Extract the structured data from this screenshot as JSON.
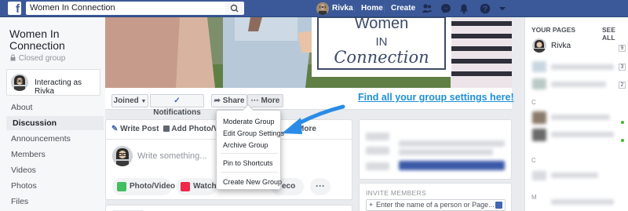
{
  "topbar": {
    "logo_letter": "f",
    "search_value": "Women In Connection",
    "user_name": "Rivka",
    "home_label": "Home",
    "create_label": "Create",
    "help_glyph": "?"
  },
  "group": {
    "title": "Women In Connection",
    "privacy": "Closed group",
    "interacting_as": "Interacting as Rivka"
  },
  "nav": {
    "items": [
      {
        "label": "About",
        "active": false
      },
      {
        "label": "Discussion",
        "active": true
      },
      {
        "label": "Announcements",
        "active": false
      },
      {
        "label": "Members",
        "active": false
      },
      {
        "label": "Videos",
        "active": false
      },
      {
        "label": "Photos",
        "active": false
      },
      {
        "label": "Files",
        "active": false
      }
    ]
  },
  "cover": {
    "sign_line1": "Women",
    "sign_line2": "IN",
    "sign_line3": "Connection"
  },
  "actions": {
    "joined": "Joined",
    "notifications": "Notifications",
    "share": "Share",
    "more": "More",
    "more_dots": "···"
  },
  "callout": "Find all your group settings here!",
  "composer": {
    "write_post": "Write Post",
    "add_photo": "Add Photo/Vid",
    "more_tab": "More",
    "placeholder": "Write something...",
    "chip_photo": "Photo/Video",
    "chip_watch": "Watch P",
    "chip_third": "eco",
    "more_chip": "···"
  },
  "menu": {
    "items": [
      "Moderate Group",
      "Edit Group Settings",
      "Archive Group",
      "Pin to Shortcuts",
      "Create New Group"
    ]
  },
  "invite": {
    "title": "INVITE MEMBERS",
    "placeholder": "Enter the name of a person or Page..."
  },
  "right_sidebar": {
    "heading": "YOUR PAGES",
    "see_all": "SEE ALL",
    "page_name": "Rivka",
    "counts": [
      "9",
      "3",
      "2"
    ],
    "blurred_letters": [
      "C",
      "C",
      "M"
    ]
  },
  "colors": {
    "facebook_blue": "#3b5998",
    "callout_blue": "#1f8fd6",
    "arrow_blue": "#2a8ce6"
  }
}
